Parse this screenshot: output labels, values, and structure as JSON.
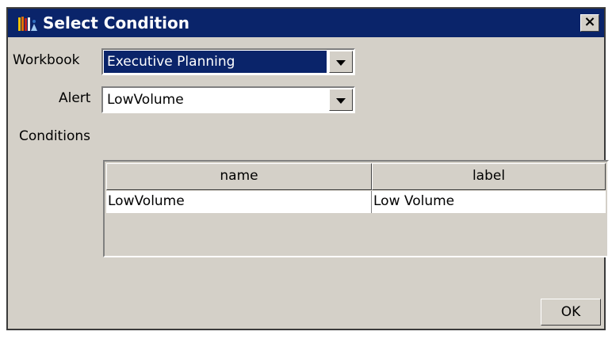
{
  "window": {
    "title": "Select Condition",
    "close_glyph": "×"
  },
  "form": {
    "workbook_label": "Workbook",
    "workbook_value": "Executive Planning",
    "alert_label": "Alert",
    "alert_value": "LowVolume",
    "conditions_label": "Conditions"
  },
  "table": {
    "columns": [
      "name",
      "label"
    ],
    "rows": [
      {
        "name": "LowVolume",
        "label": "Low Volume"
      }
    ]
  },
  "buttons": {
    "ok_label": "OK"
  },
  "icons": {
    "app": "bookshelf-icon",
    "close": "close-icon",
    "dropdown": "chevron-down-icon"
  },
  "colors": {
    "titlebar": "#0a246a",
    "face": "#d4d0c8",
    "selection": "#0a246a"
  }
}
